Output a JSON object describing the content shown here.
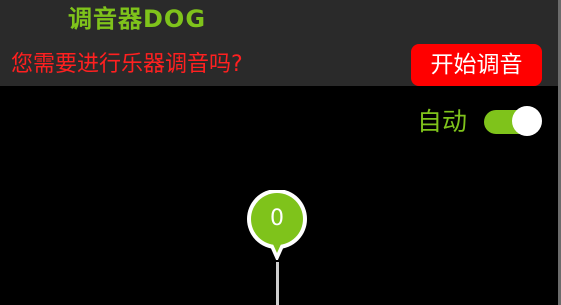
{
  "app": {
    "logo_text": "调音器DOG"
  },
  "header": {
    "prompt": "您需要进行乐器调音吗?",
    "start_button_label": "开始调音"
  },
  "controls": {
    "auto_label": "自动",
    "auto_enabled": true
  },
  "tuner": {
    "needle_value": "0"
  },
  "colors": {
    "accent_green": "#7fc31b",
    "alert_red": "#ff2020",
    "button_red": "#ff0000",
    "header_bg": "#2a2a2a",
    "background": "#000000"
  }
}
